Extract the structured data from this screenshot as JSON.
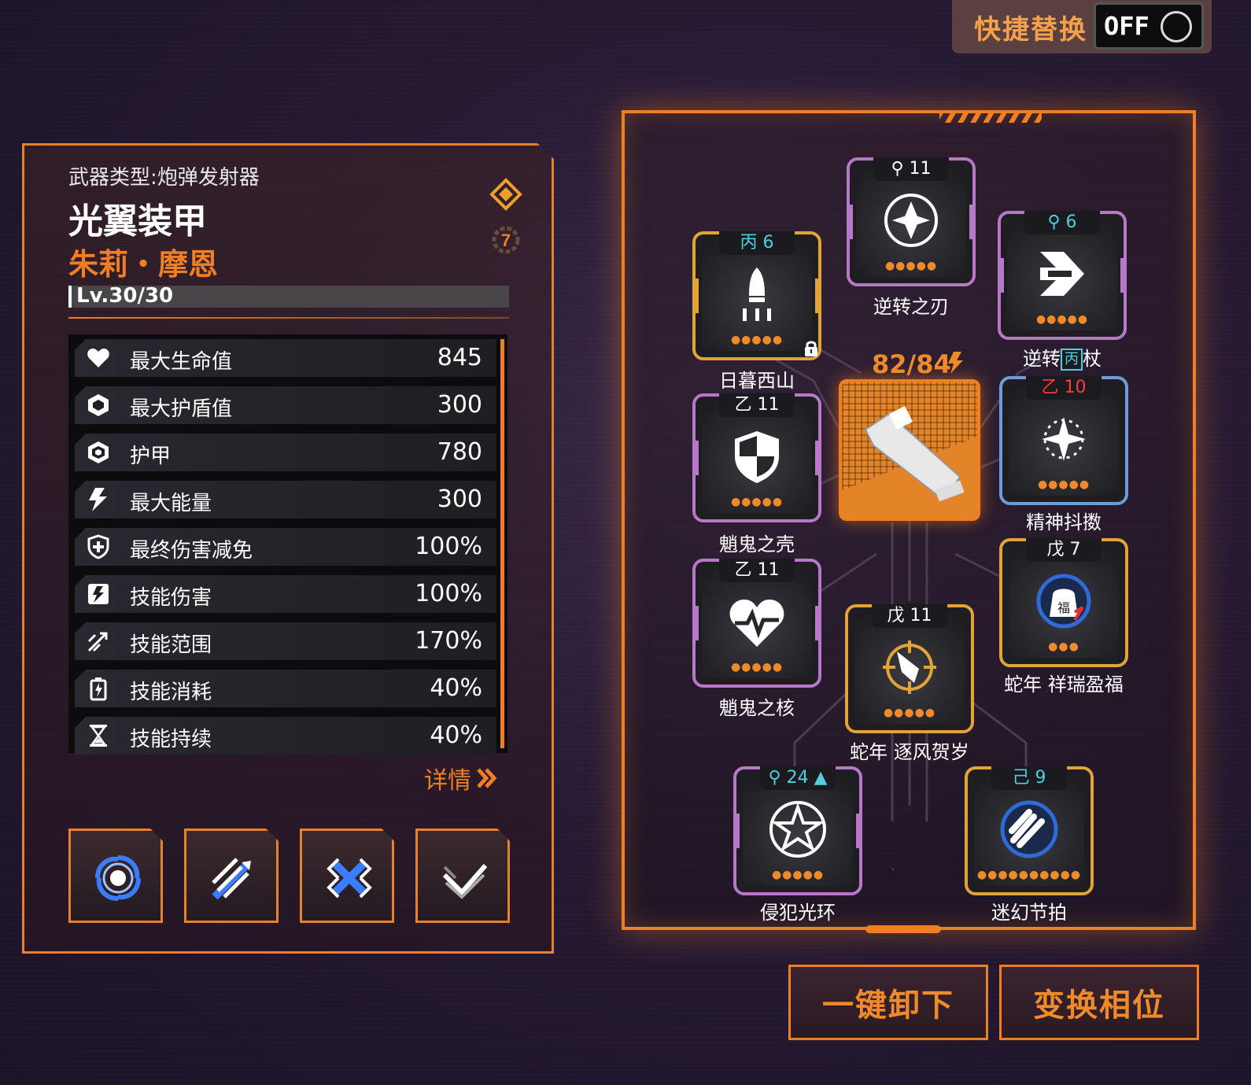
{
  "quick_replace": {
    "label": "快捷替换",
    "toggle_text": "OFF"
  },
  "weapon": {
    "type_line": "武器类型:炮弹发射器",
    "name": "光翼装甲",
    "owner": "朱莉・摩恩",
    "level_text": "Lv.30/30",
    "tier_badge": "7"
  },
  "stats": [
    {
      "icon": "heart-icon",
      "label": "最大生命值",
      "value": "845"
    },
    {
      "icon": "shield-hex-icon",
      "label": "最大护盾值",
      "value": "300"
    },
    {
      "icon": "armor-hex-icon",
      "label": "护甲",
      "value": "780"
    },
    {
      "icon": "lightning-icon",
      "label": "最大能量",
      "value": "300"
    },
    {
      "icon": "shield-plus-icon",
      "label": "最终伤害减免",
      "value": "100%"
    },
    {
      "icon": "skill-damage-icon",
      "label": "技能伤害",
      "value": "100%"
    },
    {
      "icon": "skill-range-icon",
      "label": "技能范围",
      "value": "170%"
    },
    {
      "icon": "battery-icon",
      "label": "技能消耗",
      "value": "40%"
    },
    {
      "icon": "hourglass-icon",
      "label": "技能持续",
      "value": "40%"
    }
  ],
  "detail_label": "详情",
  "skills": [
    "vortex-skill-icon",
    "missiles-skill-icon",
    "cross-skill-icon",
    "wing-skill-icon"
  ],
  "core": {
    "capacity": "82/84"
  },
  "modules": [
    {
      "key": "sunset",
      "tag": "丙 6",
      "name": "日暮西山",
      "dots": "●●●●●",
      "rank": "gold",
      "icon": "rocket-icon"
    },
    {
      "key": "reverse_blade",
      "tag": "11",
      "name": "逆转之刃",
      "dots": "●●●●●",
      "rank": "purple",
      "icon": "diamond-sparkle-icon"
    },
    {
      "key": "reverse_staff",
      "tag": "6",
      "name": "逆转之杖",
      "name_visible_left": "逆转",
      "name_visible_right": "杖",
      "dots": "●●●●●",
      "rank": "purple",
      "icon": "arrows-icon"
    },
    {
      "key": "ghost_shell",
      "tag": "乙 11",
      "name": "魈鬼之壳",
      "dots": "●●●●●",
      "rank": "purple",
      "icon": "shield-icon"
    },
    {
      "key": "spirit",
      "tag": "乙 10",
      "name": "精神抖擞",
      "dots": "●●●●●",
      "rank": "blue",
      "icon": "sparkles-icon"
    },
    {
      "key": "ghost_core",
      "tag": "乙 11",
      "name": "魈鬼之核",
      "dots": "●●●●●",
      "rank": "purple",
      "icon": "heart-pulse-icon"
    },
    {
      "key": "snake_wind",
      "tag": "戊 11",
      "name": "蛇年 逐风贺岁",
      "dots": "●●●●●",
      "rank": "gold",
      "icon": "firework-icon"
    },
    {
      "key": "snake_luck",
      "tag": "戊 7",
      "name": "蛇年 祥瑞盈福",
      "dots": "●●●",
      "rank": "gold",
      "icon": "lucky-bag-icon"
    },
    {
      "key": "invader",
      "tag": "24",
      "name": "侵犯光环",
      "dots": "●●●●●",
      "rank": "purple",
      "icon": "star-ring-icon"
    },
    {
      "key": "rhythm",
      "tag": "己 9",
      "name": "迷幻节拍",
      "dots": "●●●●●●●●●●",
      "rank": "gold",
      "icon": "bullets-icon"
    }
  ],
  "overlay_tag": "丙",
  "buttons": {
    "unload_all": "一键卸下",
    "swap_phase": "变换相位"
  },
  "colors": {
    "accent": "#ef7f22",
    "purple_rank": "#b878c8",
    "gold_rank": "#e2a33a",
    "blue_rank": "#6e9cd8",
    "tag_cyan": "#4fd0e0",
    "tag_red": "#ff3a3a"
  }
}
